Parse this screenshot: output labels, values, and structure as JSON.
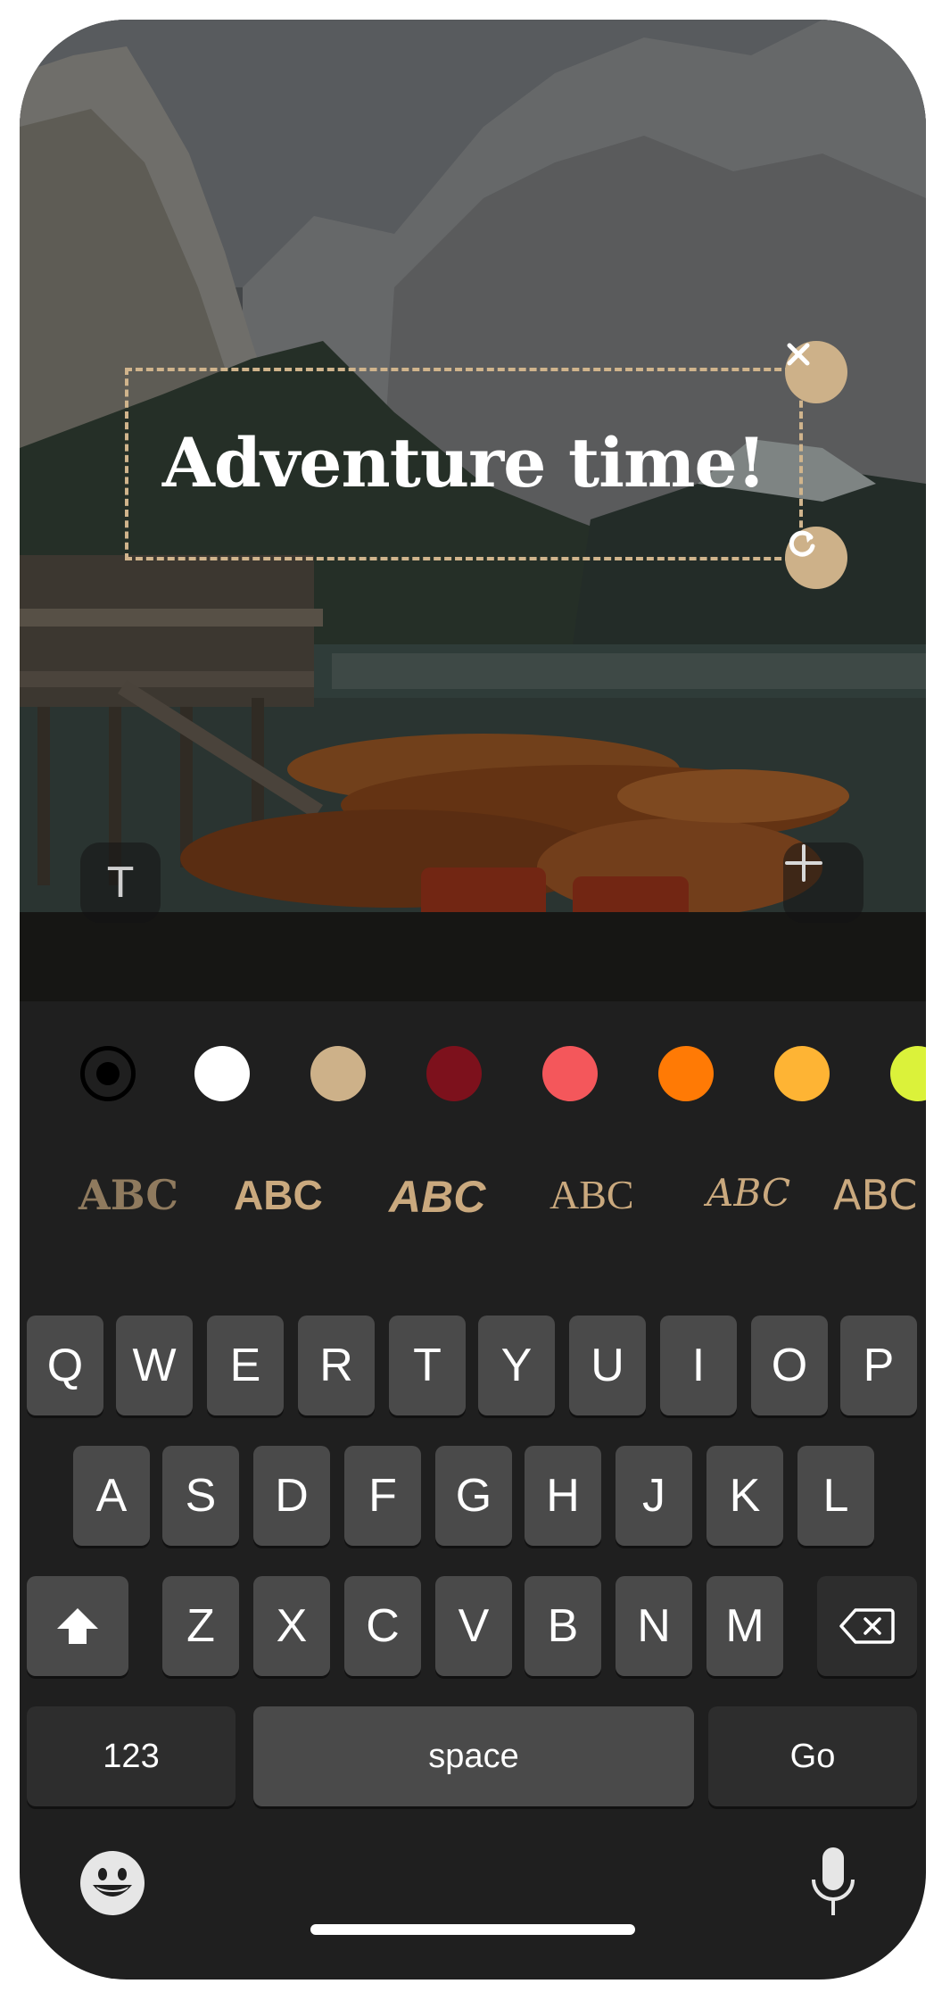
{
  "editor": {
    "text_overlay": "Adventure time!",
    "accent_color": "#cdb189"
  },
  "toolbar": {
    "text_tool_label": "T",
    "add_label": "+"
  },
  "colors": [
    {
      "name": "picker",
      "hex": ""
    },
    {
      "name": "white",
      "hex": "#ffffff"
    },
    {
      "name": "tan",
      "hex": "#cdb189"
    },
    {
      "name": "dark-red",
      "hex": "#7d111c"
    },
    {
      "name": "coral",
      "hex": "#f4575b"
    },
    {
      "name": "orange",
      "hex": "#ff7a05"
    },
    {
      "name": "yellow",
      "hex": "#feb434"
    },
    {
      "name": "lime",
      "hex": "#dbf23a"
    }
  ],
  "fonts": [
    {
      "label": "ABC",
      "style": "serif"
    },
    {
      "label": "ABC",
      "style": "sans-bold"
    },
    {
      "label": "ABC",
      "style": "sans-bold-italic"
    },
    {
      "label": "ABC",
      "style": "serif-outline"
    },
    {
      "label": "ABC",
      "style": "script"
    },
    {
      "label": "ABC",
      "style": "sans"
    }
  ],
  "keyboard": {
    "row1": [
      "Q",
      "W",
      "E",
      "R",
      "T",
      "Y",
      "U",
      "I",
      "O",
      "P"
    ],
    "row2": [
      "A",
      "S",
      "D",
      "F",
      "G",
      "H",
      "J",
      "K",
      "L"
    ],
    "row3": [
      "Z",
      "X",
      "C",
      "V",
      "B",
      "N",
      "M"
    ],
    "numbers_label": "123",
    "space_label": "space",
    "go_label": "Go"
  },
  "icons": {
    "close": "close-icon",
    "rotate": "rotate-icon",
    "shift": "shift-icon",
    "delete": "backspace-icon",
    "emoji": "emoji-icon",
    "mic": "microphone-icon"
  }
}
